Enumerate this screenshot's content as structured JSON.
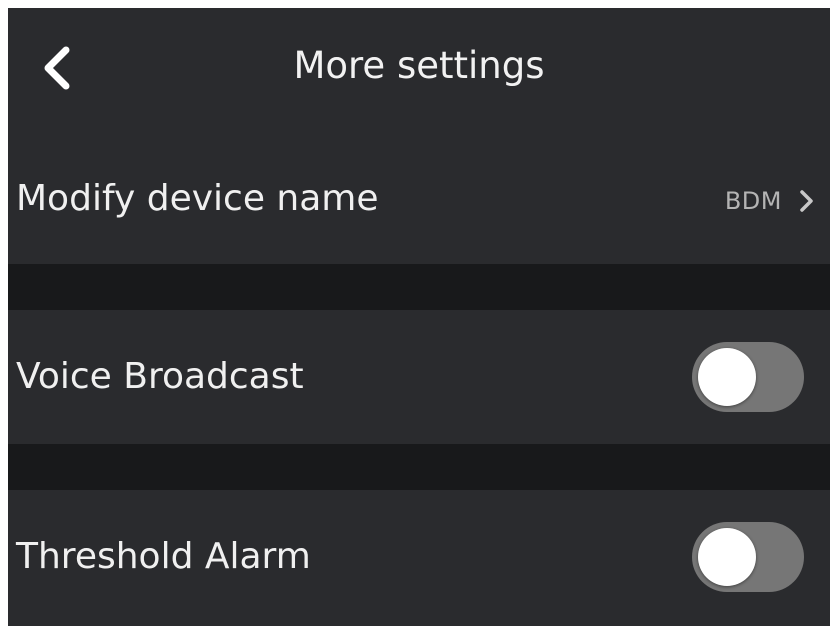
{
  "header": {
    "title": "More settings",
    "back_icon": "chevron-left-icon"
  },
  "settings": {
    "device_name": {
      "label": "Modify device name",
      "value": "BDM",
      "chevron_icon": "chevron-right-icon"
    },
    "voice_broadcast": {
      "label": "Voice Broadcast",
      "enabled": false
    },
    "threshold_alarm": {
      "label": "Threshold Alarm",
      "enabled": false
    }
  },
  "colors": {
    "background": "#18191b",
    "row_background": "#2a2b2e",
    "text": "#f0f0f0",
    "secondary_text": "#b4b4b4",
    "toggle_off_track": "#767676",
    "toggle_knob": "#ffffff"
  }
}
